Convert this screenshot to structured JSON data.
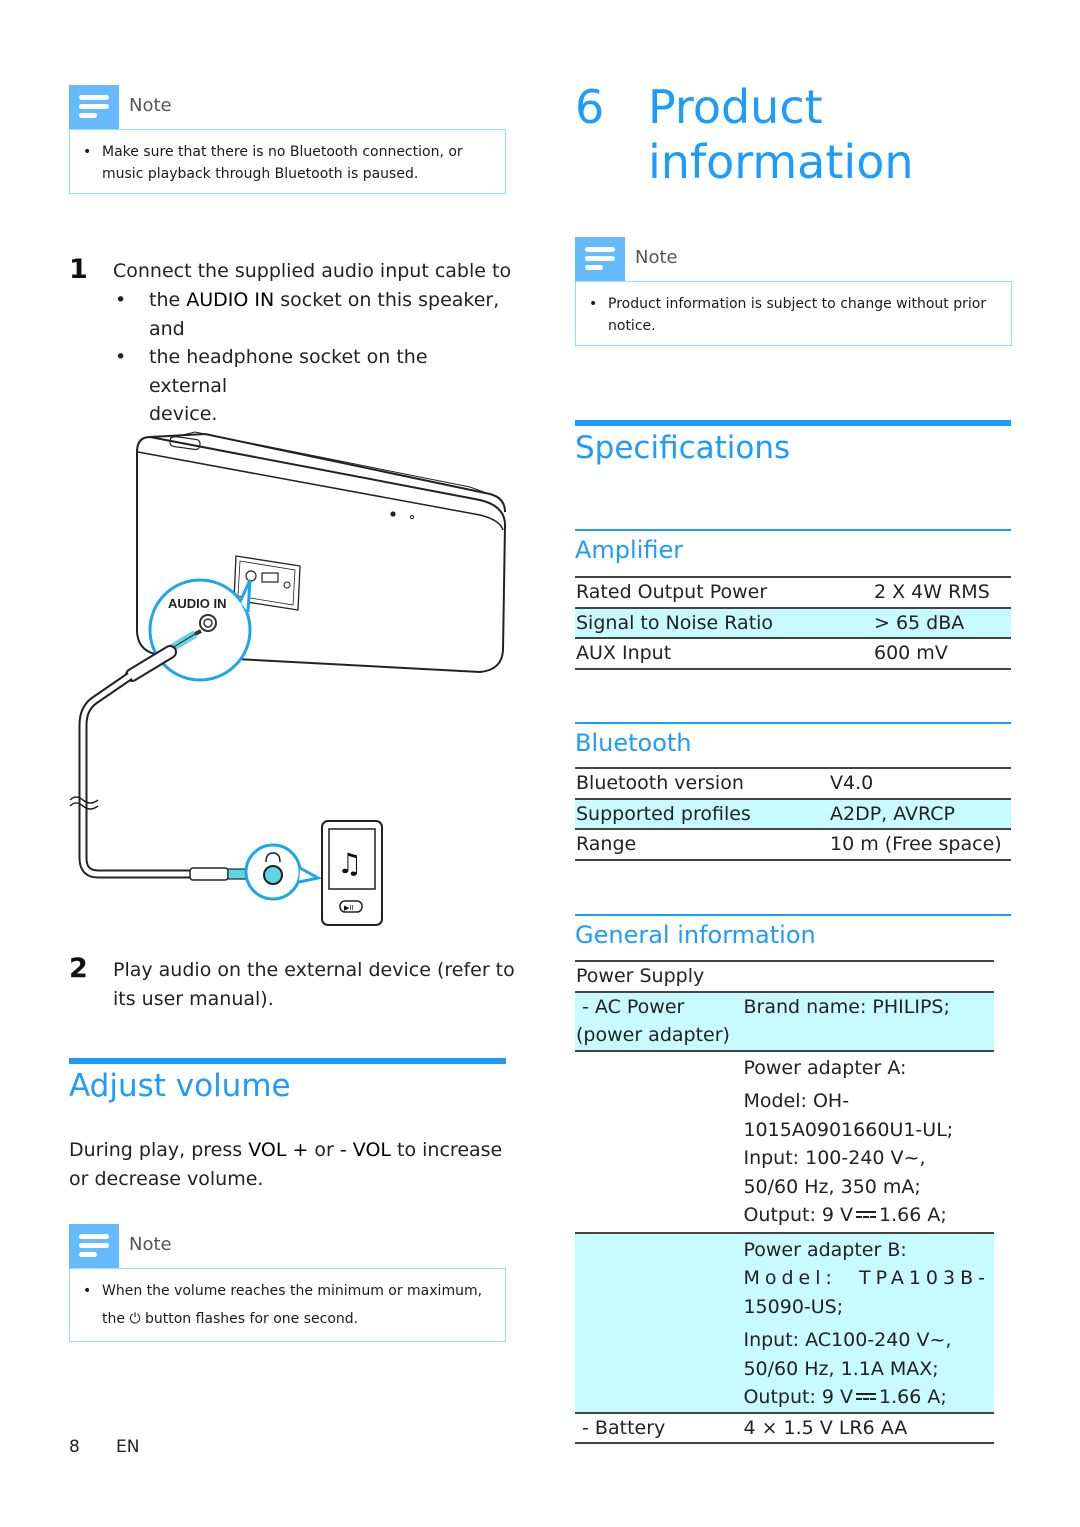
{
  "left": {
    "note1": {
      "title": "Note",
      "bullet": "•",
      "text": "Make sure that there is no Bluetooth connection, or music playback through Bluetooth is paused."
    },
    "steps": [
      {
        "number": "1",
        "text": "Connect the supplied audio input cable to",
        "bullets": [
          {
            "prefix": "the ",
            "strong": "AUDIO IN",
            "suffix": " socket on this speaker,",
            "line2": "and"
          },
          {
            "prefix": "the headphone socket on the external",
            "strong": "",
            "suffix": "",
            "line2": "device."
          }
        ]
      },
      {
        "number": "2",
        "line1": "Play audio on the external device (refer to",
        "line2": "its user manual)."
      }
    ],
    "illustration": {
      "callout_label": "AUDIO IN",
      "speaker_icon": "speaker-illustration",
      "player_icon": "music-player-illustration",
      "headphone_icon": "headphone-jack-icon"
    },
    "adjust_volume": {
      "heading": "Adjust volume",
      "line1_a": "During play, press ",
      "line1_b": "VOL +",
      "line1_c": " or ",
      "line1_d": "- VOL",
      "line1_e": " to increase",
      "line2": "or decrease volume."
    },
    "note2": {
      "title": "Note",
      "bullet": "•",
      "line1": "When the volume reaches the minimum or maximum,",
      "line2_a": "the ",
      "power_glyph": "⏻",
      "line2_b": " button flashes for one second."
    },
    "footer": {
      "page": "8",
      "lang": "EN"
    }
  },
  "right": {
    "chapter_number": "6",
    "chapter_title_1": "Product",
    "chapter_title_2": "information",
    "note": {
      "title": "Note",
      "bullet": "•",
      "line1": "Product information is subject to change without prior",
      "line2": "notice."
    },
    "specifications_heading": "Specifications",
    "amplifier": {
      "heading": "Amplifier",
      "rows": [
        {
          "label": "Rated Output Power",
          "value": "2 X 4W RMS"
        },
        {
          "label": "Signal to Noise Ratio",
          "value": "> 65 dBA"
        },
        {
          "label": "AUX Input",
          "value": "600 mV"
        }
      ]
    },
    "bluetooth": {
      "heading": "Bluetooth",
      "rows": [
        {
          "label": "Bluetooth version",
          "value": "V4.0"
        },
        {
          "label": "Supported profiles",
          "value": "A2DP, AVRCP"
        },
        {
          "label": "Range",
          "value": "10 m (Free space)"
        }
      ]
    },
    "general": {
      "heading": "General information",
      "power_supply": "Power Supply",
      "ac_power_1": " - AC Power",
      "ac_power_2": "(power adapter)",
      "brand": "Brand name: PHILIPS;",
      "adapter_a": {
        "title": "Power adapter A:",
        "model_1": "Model: OH-",
        "model_2": "1015A0901660U1-UL;",
        "input_1": "Input: 100-240 V~,",
        "input_2": "50/60 Hz, 350 mA;",
        "output_a": "Output: 9 V",
        "output_b": "1.66 A;"
      },
      "adapter_b": {
        "title": "Power adapter B:",
        "model_1": "Model:  TPA103B-",
        "model_2": "15090-US;",
        "input_1": "Input: AC100-240 V~,",
        "input_2": "50/60 Hz, 1.1A MAX;",
        "output_a": "Output: 9 V",
        "output_b": "1.66 A;"
      },
      "battery_label": " - Battery",
      "battery_value": "4 × 1.5 V LR6 AA"
    }
  },
  "colors": {
    "accent": "#1e9bff",
    "note_tab": "#66bbff",
    "note_border": "#99ddf5",
    "row_shade": "#c8fbff",
    "callout": "#1aa6ee",
    "plug_tip": "#5fd6dd"
  }
}
